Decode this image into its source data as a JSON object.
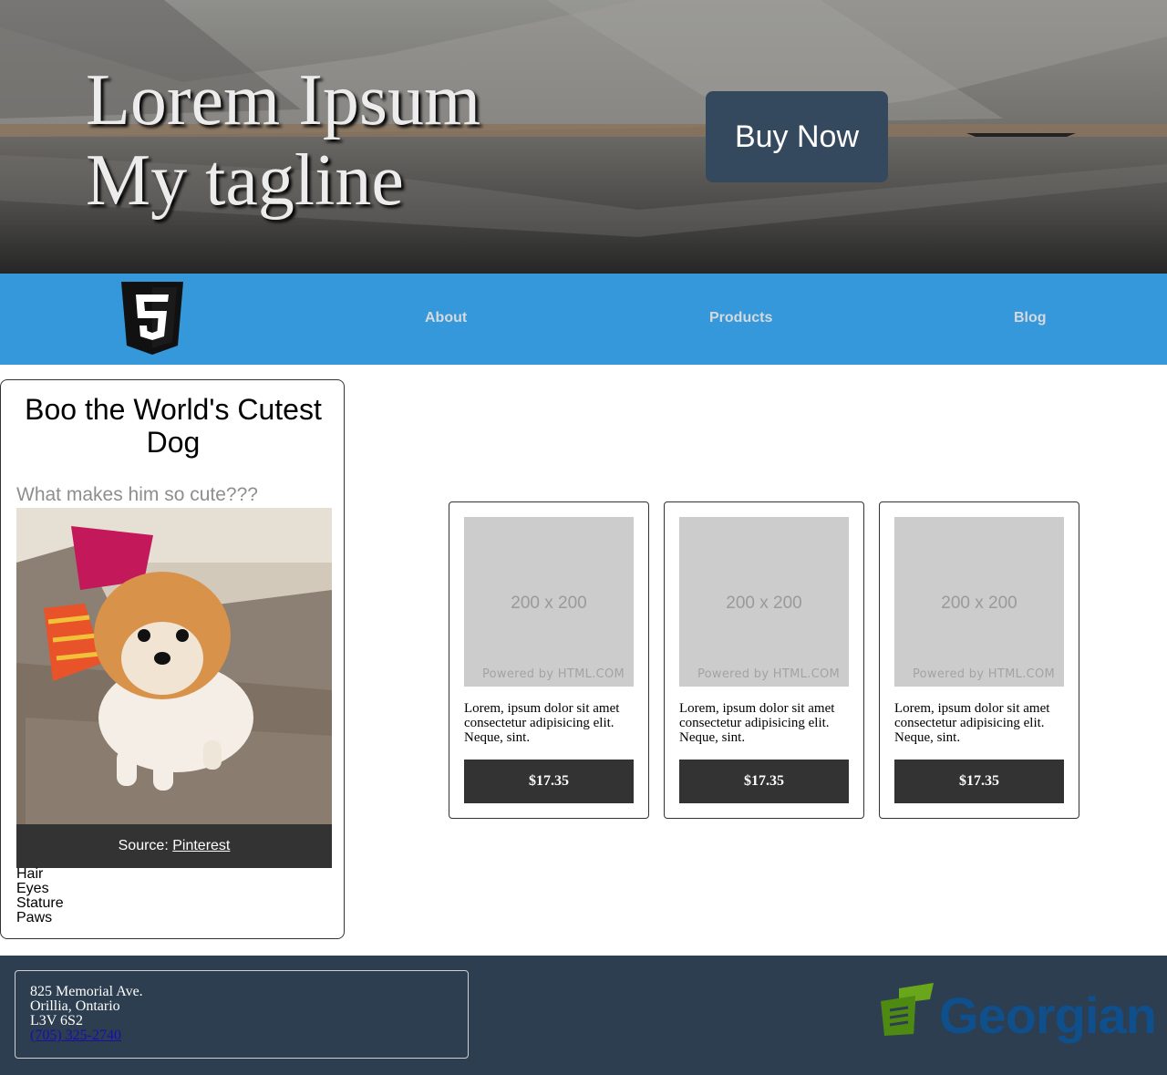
{
  "hero": {
    "title_line1": "Lorem Ipsum",
    "title_line2": "My tagline",
    "buy_label": "Buy Now"
  },
  "nav": {
    "logo_digit": "5",
    "items": [
      {
        "label": "About"
      },
      {
        "label": "Products"
      },
      {
        "label": "Blog"
      }
    ]
  },
  "dog_card": {
    "title": "Boo the World's Cutest Dog",
    "subtitle": "What makes him so cute???",
    "caption_prefix": "Source: ",
    "caption_link": "Pinterest",
    "traits": [
      "Hair",
      "Eyes",
      "Stature",
      "Paws"
    ]
  },
  "products": [
    {
      "placeholder": "200 x 200",
      "powered": "Powered by HTML.COM",
      "description": "Lorem, ipsum dolor sit amet consectetur adipisicing elit. Neque, sint.",
      "price": "$17.35"
    },
    {
      "placeholder": "200 x 200",
      "powered": "Powered by HTML.COM",
      "description": "Lorem, ipsum dolor sit amet consectetur adipisicing elit. Neque, sint.",
      "price": "$17.35"
    },
    {
      "placeholder": "200 x 200",
      "powered": "Powered by HTML.COM",
      "description": "Lorem, ipsum dolor sit amet consectetur adipisicing elit. Neque, sint.",
      "price": "$17.35"
    }
  ],
  "footer": {
    "address": [
      "825 Memorial Ave.",
      "Orillia, Ontario",
      "L3V 6S2"
    ],
    "phone": "(705) 325-2740",
    "logo_word": "Georgian"
  },
  "colors": {
    "nav_bg": "#3498db",
    "buy_button": "#34495e",
    "footer_bg": "#2c3e50",
    "dark_button": "#333333"
  }
}
